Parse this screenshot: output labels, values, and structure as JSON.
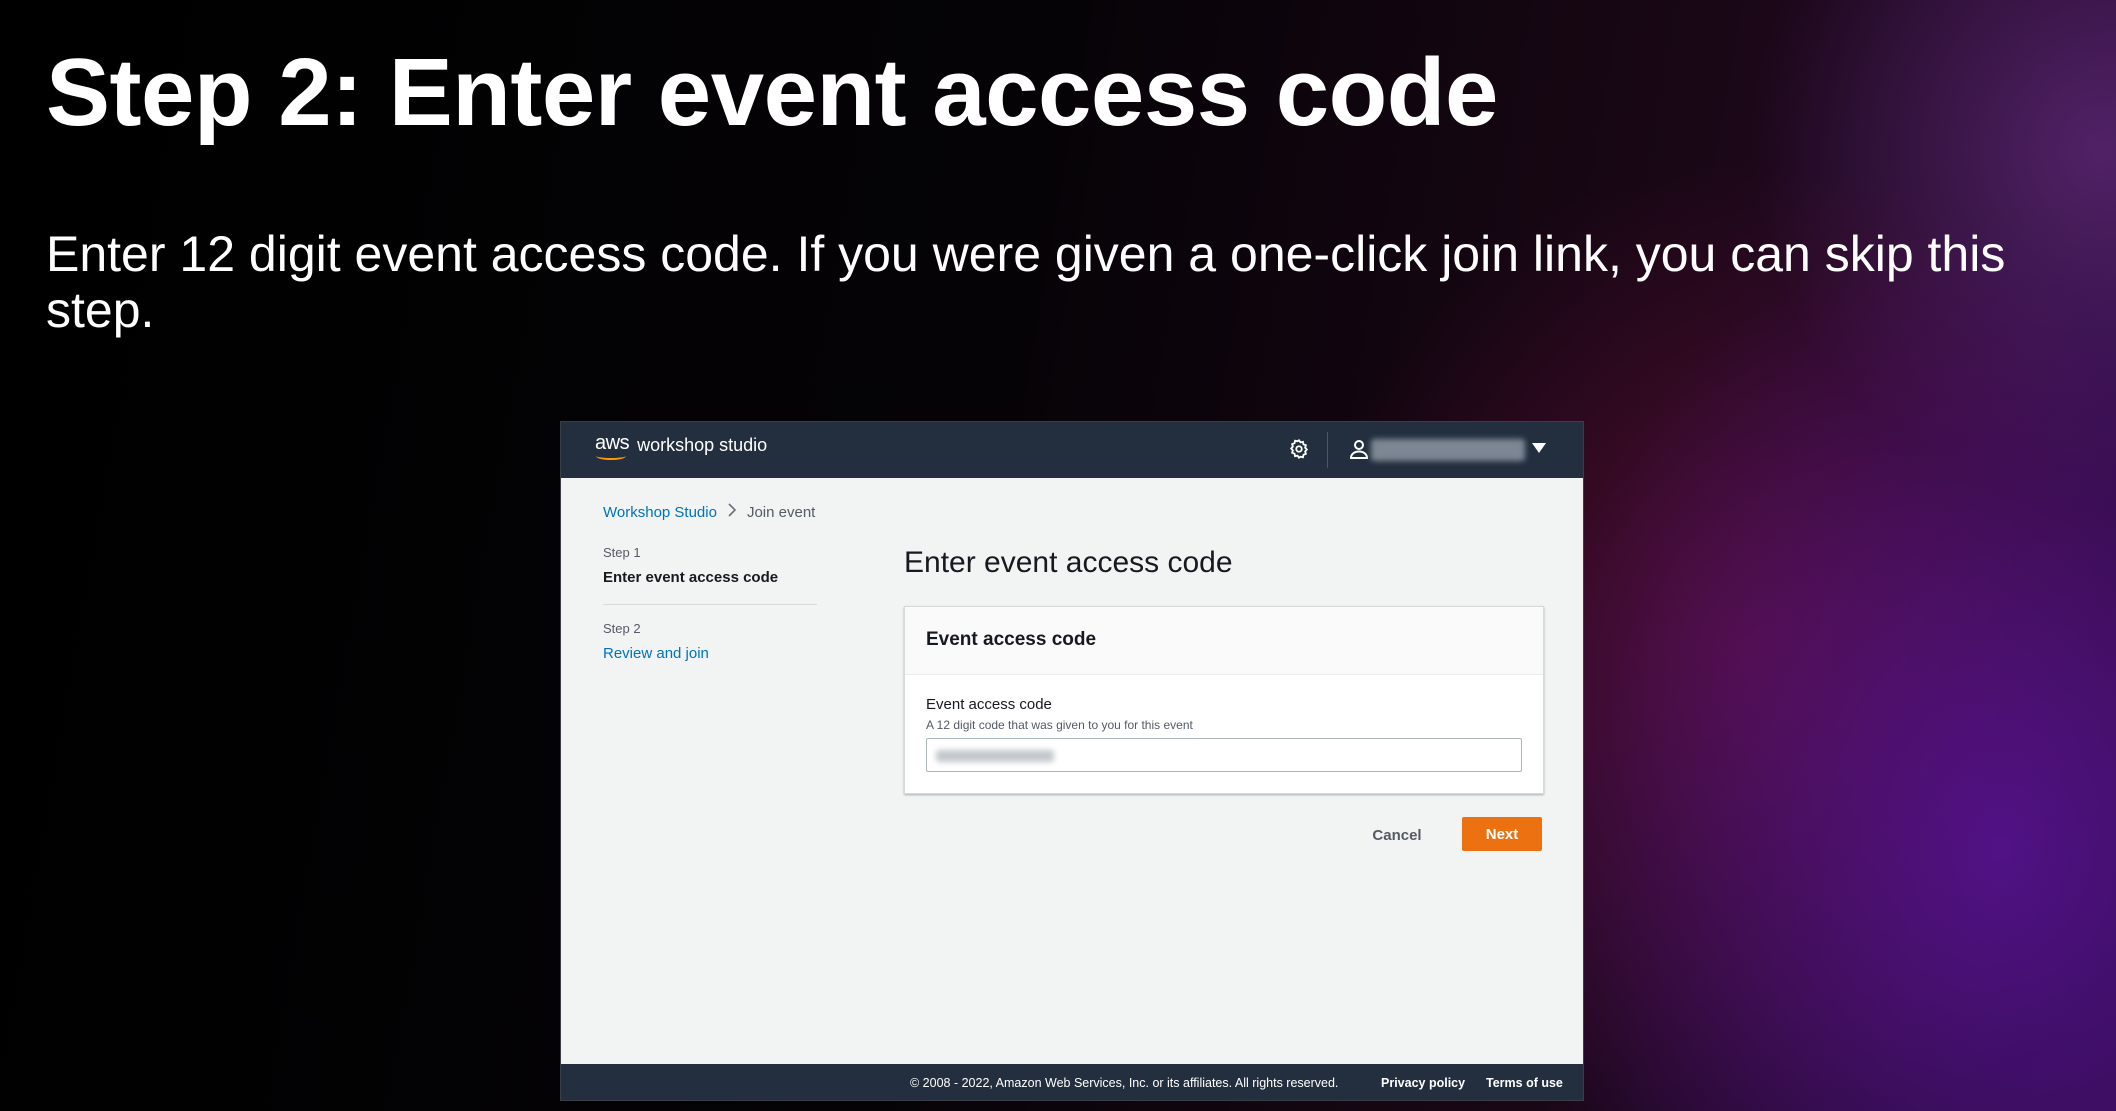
{
  "slide": {
    "title": "Step 2: Enter event access code",
    "subtitle": "Enter 12 digit event access code. If you were given a one-click join link, you can skip this step."
  },
  "topnav": {
    "logo_mark": "aws",
    "logo_text": "workshop studio",
    "icons": [
      "gear-icon",
      "user-icon",
      "caret-down-icon"
    ]
  },
  "breadcrumb": {
    "items": [
      "Workshop Studio",
      "Join event"
    ],
    "separator": ">"
  },
  "steps": [
    {
      "label": "Step 1",
      "title": "Enter event access code",
      "state": "current"
    },
    {
      "label": "Step 2",
      "title": "Review and join",
      "state": "upcoming"
    }
  ],
  "main": {
    "heading": "Enter event access code",
    "card": {
      "header": "Event access code",
      "field_label": "Event access code",
      "field_description": "A 12 digit code that was given to you for this event",
      "field_value": ""
    },
    "cancel_label": "Cancel",
    "next_label": "Next"
  },
  "footer": {
    "copyright": "© 2008 - 2022, Amazon Web Services, Inc. or its affiliates. All rights reserved.",
    "privacy": "Privacy policy",
    "terms": "Terms of use"
  },
  "colors": {
    "nav_bg": "#232f3e",
    "link": "#0073bb",
    "primary_button": "#ec7211",
    "aws_smile": "#ff9900"
  }
}
